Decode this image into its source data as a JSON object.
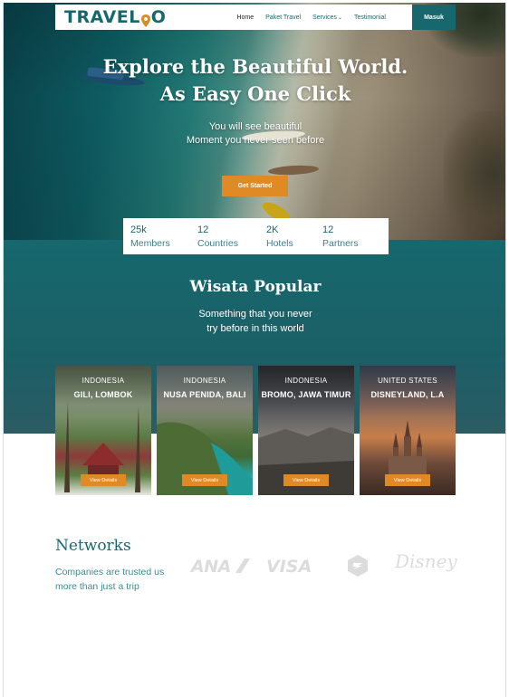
{
  "brand": {
    "logo_text_a": "TRAVEL",
    "logo_text_b": "O",
    "accent": "#16686e",
    "cta_color": "#e08a25"
  },
  "nav": {
    "links": [
      "Home",
      "Paket Travel",
      "Services",
      "Testimonial"
    ],
    "login_label": "Masuk"
  },
  "hero": {
    "title_line1": "Explore the Beautiful World.",
    "title_line2": "As Easy One Click",
    "subtitle_line1": "You will see beautiful",
    "subtitle_line2": "Moment you never seen before",
    "cta_label": "Get Started"
  },
  "stats": [
    {
      "value": "25k",
      "label": "Members"
    },
    {
      "value": "12",
      "label": "Countries"
    },
    {
      "value": "2K",
      "label": "Hotels"
    },
    {
      "value": "12",
      "label": "Partners"
    }
  ],
  "popular": {
    "title": "Wisata Popular",
    "subtitle_line1": "Something that you never",
    "subtitle_line2": "try before in this world",
    "cards": [
      {
        "country": "INDONESIA",
        "place": "GILI, LOMBOK",
        "button": "View Details"
      },
      {
        "country": "INDONESIA",
        "place": "NUSA PENIDA, BALI",
        "button": "View Details"
      },
      {
        "country": "INDONESIA",
        "place": "BROMO, JAWA TIMUR",
        "button": "View Details"
      },
      {
        "country": "UNITED STATES",
        "place": "DISNEYLAND, L.A",
        "button": "View Details"
      }
    ]
  },
  "networks": {
    "title": "Networks",
    "subtitle_line1": "Companies are trusted us",
    "subtitle_line2": "more than just a trip",
    "logos": [
      "ANA",
      "VISA",
      "emblem-logo",
      "Disney"
    ]
  }
}
